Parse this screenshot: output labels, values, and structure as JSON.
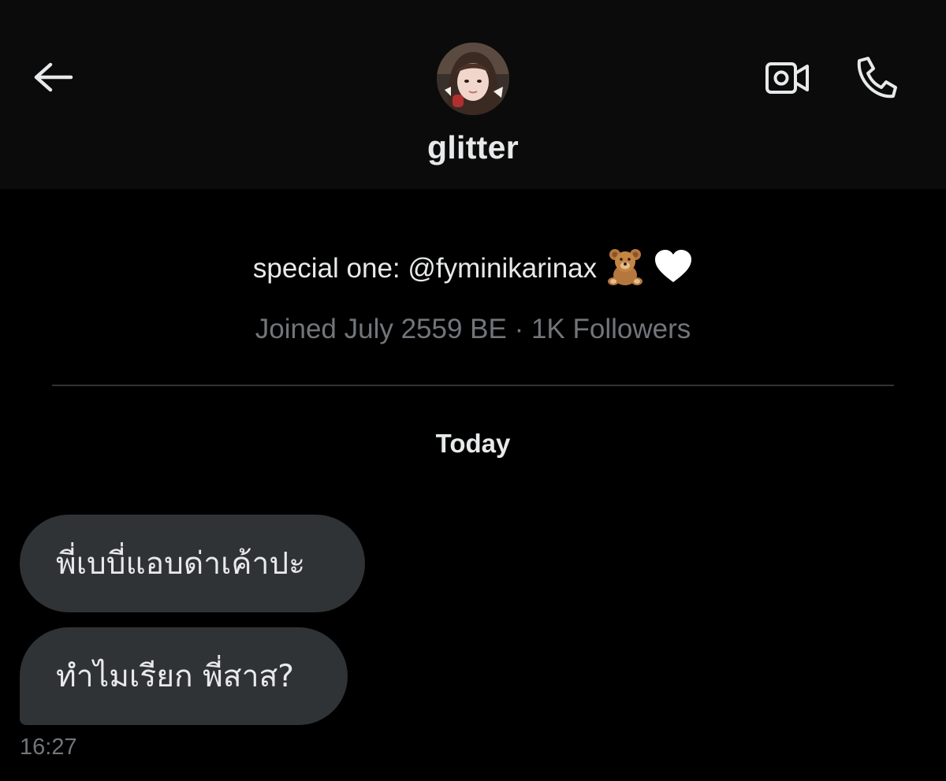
{
  "header": {
    "title": "glitter",
    "icons": {
      "back": "arrow-left-icon",
      "video": "video-call-icon",
      "phone": "phone-call-icon"
    }
  },
  "profile": {
    "bio_text": "special one: @fyminikarinax",
    "bio_emojis": [
      "teddy-bear",
      "white-heart"
    ],
    "meta": "Joined July 2559 BE · 1K Followers"
  },
  "chat": {
    "date_separator": "Today",
    "messages": [
      {
        "text": "พี่เบบี่แอบด่าเค้าปะ"
      },
      {
        "text": "ทำไมเรียก พี่สาส?"
      }
    ],
    "timestamp": "16:27"
  },
  "colors": {
    "background": "#000000",
    "header_background": "#0b0b0b",
    "bubble": "#2f3336",
    "text": "#e7e9ea",
    "secondary_text": "#71767b"
  }
}
